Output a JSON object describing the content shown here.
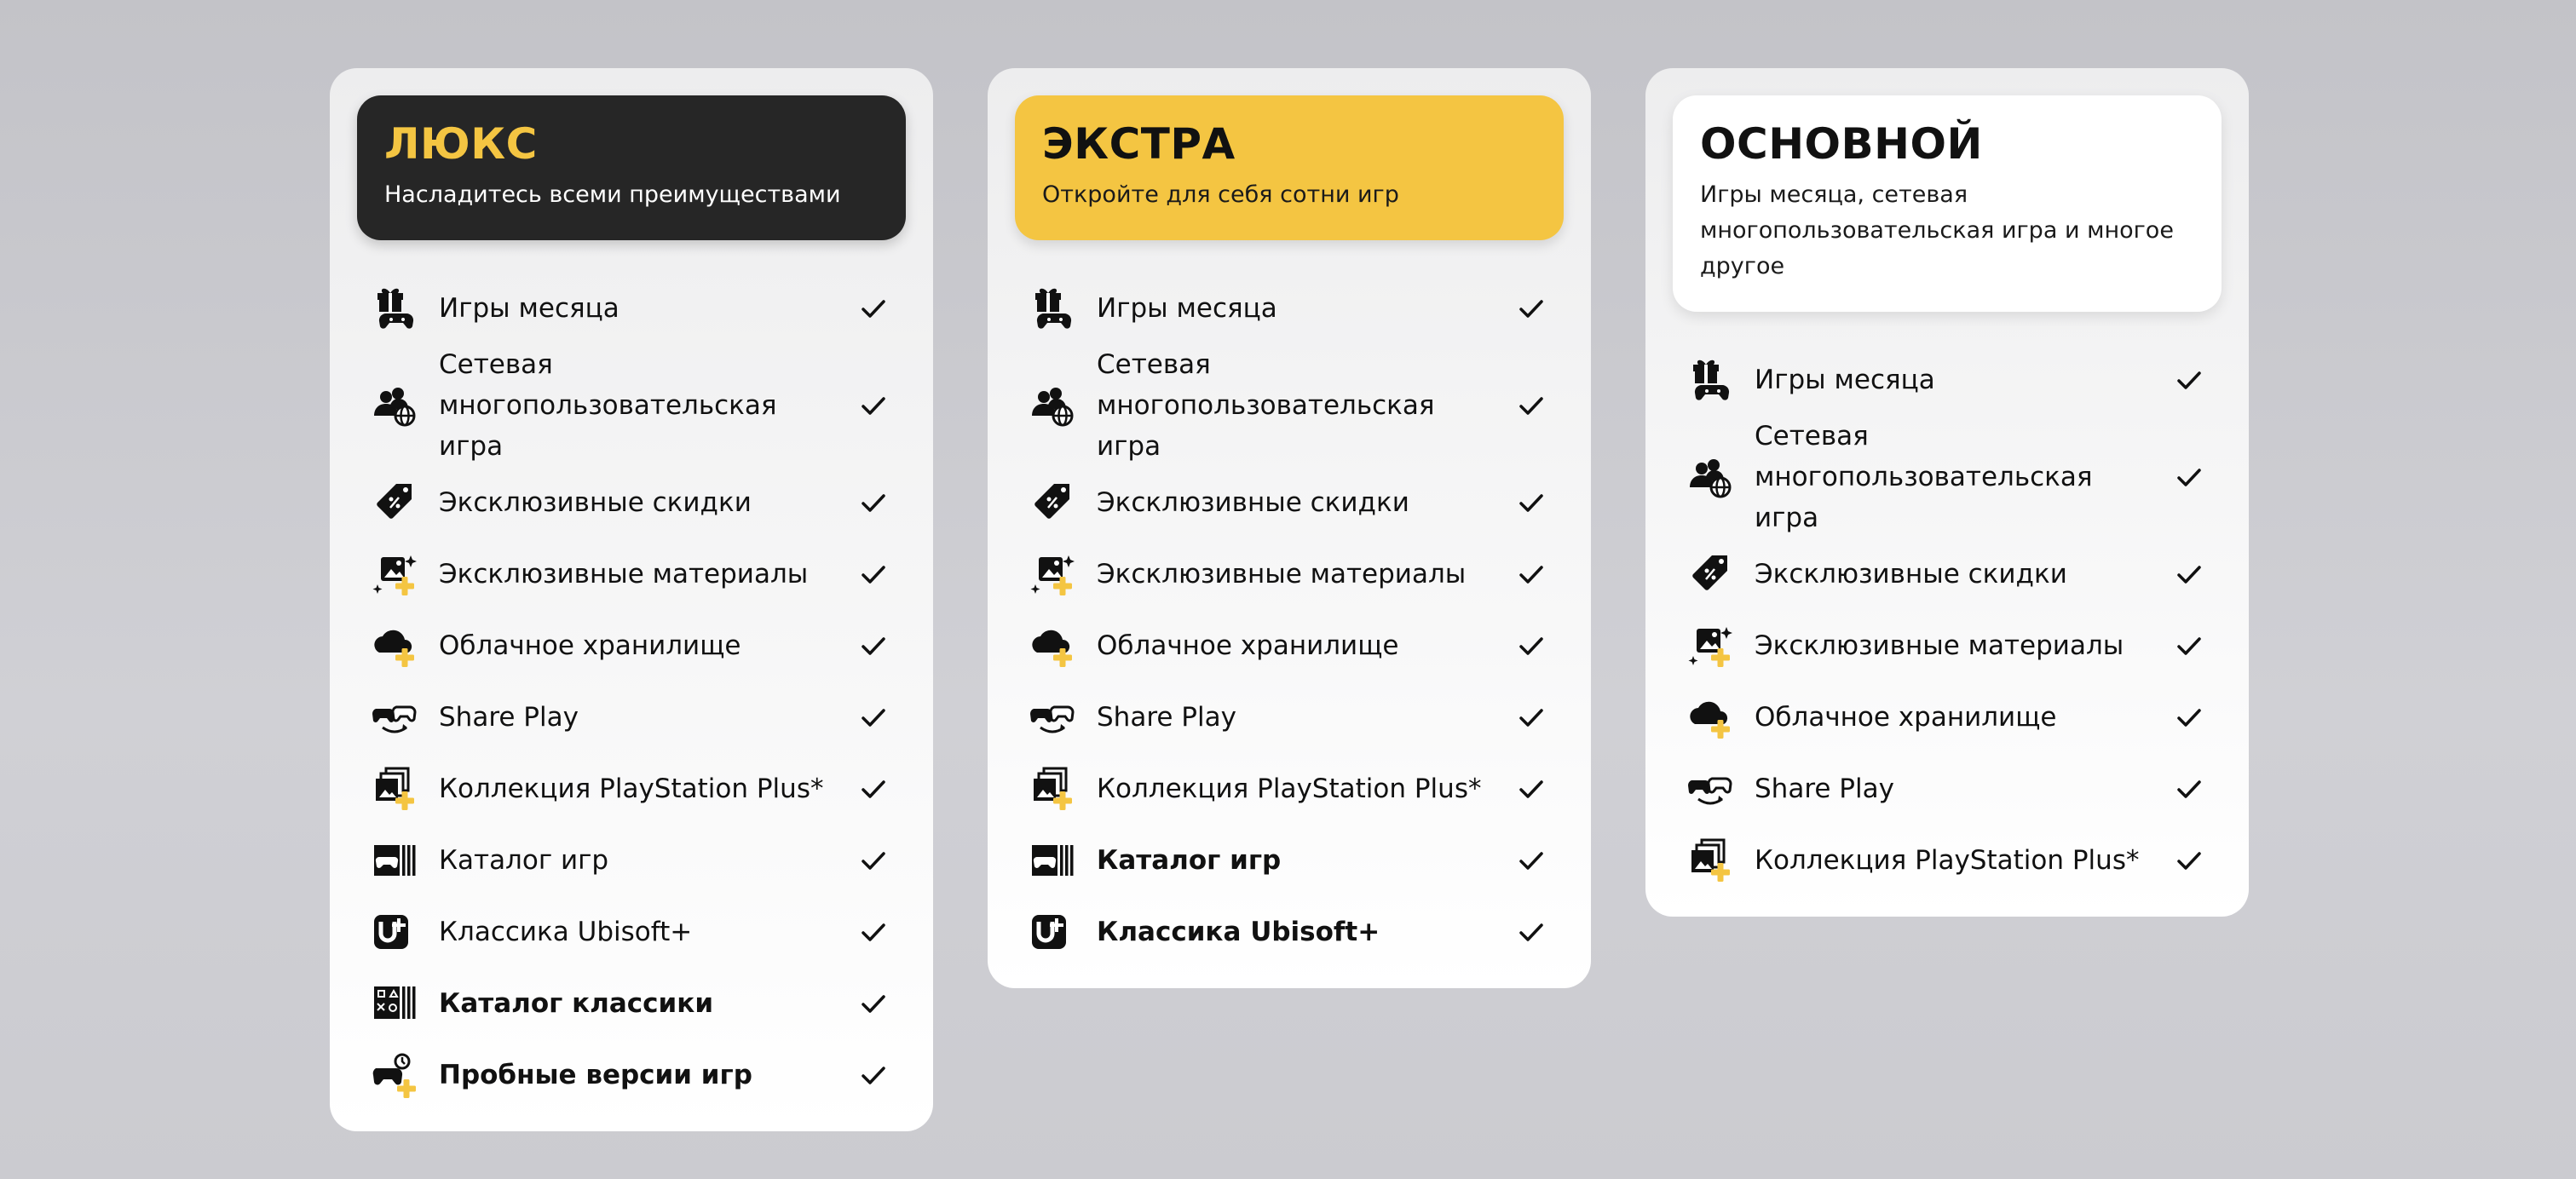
{
  "accent_colors": {
    "yellow": "#f4c542",
    "dark": "#262626"
  },
  "plans": [
    {
      "name": "ЛЮКС",
      "tagline": "Насладитесь всеми преимуществами",
      "features": [
        {
          "label": "Игры месяца",
          "icon": "gift-controller-icon"
        },
        {
          "label": "Сетевая многопользовательская игра",
          "icon": "multiplayer-globe-icon"
        },
        {
          "label": "Эксклюзивные скидки",
          "icon": "discount-tag-icon"
        },
        {
          "label": "Эксклюзивные материалы",
          "icon": "exclusive-content-icon"
        },
        {
          "label": "Облачное хранилище",
          "icon": "cloud-storage-icon"
        },
        {
          "label": "Share Play",
          "icon": "share-play-icon"
        },
        {
          "label": "Коллекция PlayStation Plus*",
          "icon": "ps-plus-collection-icon"
        },
        {
          "label": "Каталог игр",
          "icon": "game-catalog-icon"
        },
        {
          "label": "Классика Ubisoft+",
          "icon": "ubisoft-plus-icon"
        },
        {
          "label": "Каталог классики",
          "icon": "classics-catalog-icon",
          "bold": true
        },
        {
          "label": "Пробные версии игр",
          "icon": "game-trials-icon",
          "bold": true
        }
      ]
    },
    {
      "name": "ЭКСТРА",
      "tagline": "Откройте для себя сотни игр",
      "features": [
        {
          "label": "Игры месяца",
          "icon": "gift-controller-icon"
        },
        {
          "label": "Сетевая многопользовательская игра",
          "icon": "multiplayer-globe-icon"
        },
        {
          "label": "Эксклюзивные скидки",
          "icon": "discount-tag-icon"
        },
        {
          "label": "Эксклюзивные материалы",
          "icon": "exclusive-content-icon"
        },
        {
          "label": "Облачное хранилище",
          "icon": "cloud-storage-icon"
        },
        {
          "label": "Share Play",
          "icon": "share-play-icon"
        },
        {
          "label": "Коллекция PlayStation Plus*",
          "icon": "ps-plus-collection-icon"
        },
        {
          "label": "Каталог игр",
          "icon": "game-catalog-icon",
          "bold": true
        },
        {
          "label": "Классика Ubisoft+",
          "icon": "ubisoft-plus-icon",
          "bold": true
        }
      ]
    },
    {
      "name": "ОСНОВНОЙ",
      "tagline": "Игры месяца, сетевая многопользовательская игра и многое другое",
      "features": [
        {
          "label": "Игры месяца",
          "icon": "gift-controller-icon"
        },
        {
          "label": "Сетевая многопользовательская игра",
          "icon": "multiplayer-globe-icon"
        },
        {
          "label": "Эксклюзивные скидки",
          "icon": "discount-tag-icon"
        },
        {
          "label": "Эксклюзивные материалы",
          "icon": "exclusive-content-icon"
        },
        {
          "label": "Облачное хранилище",
          "icon": "cloud-storage-icon"
        },
        {
          "label": "Share Play",
          "icon": "share-play-icon"
        },
        {
          "label": "Коллекция PlayStation Plus*",
          "icon": "ps-plus-collection-icon"
        }
      ]
    }
  ]
}
